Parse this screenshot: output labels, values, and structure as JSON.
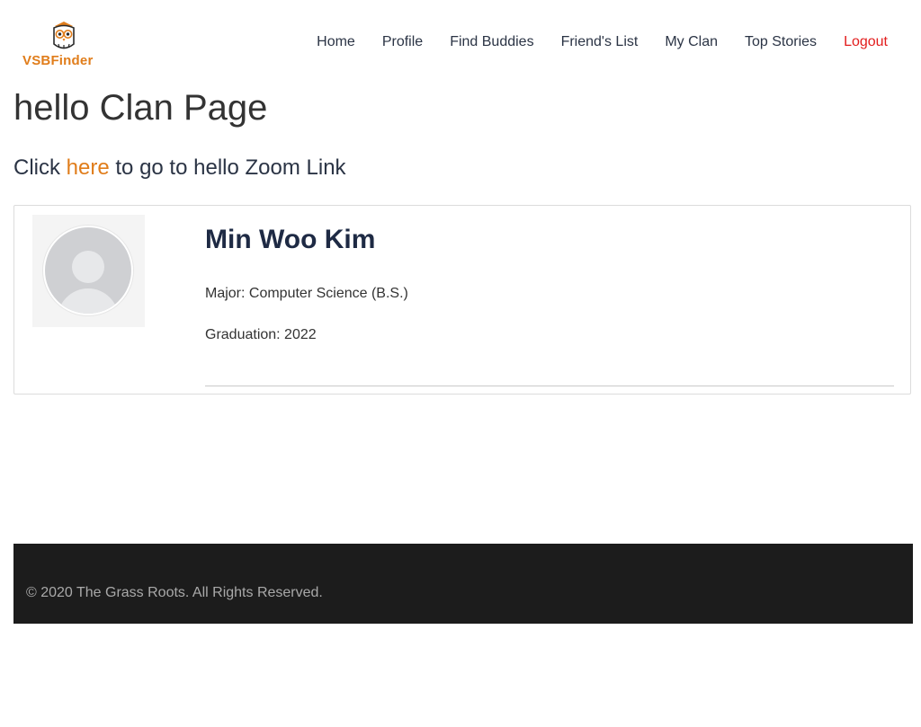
{
  "brand": {
    "logo_text": "VSBFinder",
    "logo_icon": "owl-icon",
    "accent_color": "#e07d1b"
  },
  "nav": {
    "items": [
      "Home",
      "Profile",
      "Find Buddies",
      "Friend's List",
      "My Clan",
      "Top Stories"
    ],
    "logout": "Logout",
    "logout_color": "#e21d1d"
  },
  "page": {
    "title": "hello Clan Page",
    "zoom_prefix": "Click ",
    "zoom_link": "here",
    "zoom_suffix": " to go to hello Zoom Link"
  },
  "members": [
    {
      "name": "Min Woo Kim",
      "major": "Major: Computer Science (B.S.)",
      "graduation": "Graduation: 2022",
      "avatar_icon": "default-avatar-icon"
    }
  ],
  "footer": {
    "copyright": "© 2020 The Grass Roots. All Rights Reserved."
  }
}
